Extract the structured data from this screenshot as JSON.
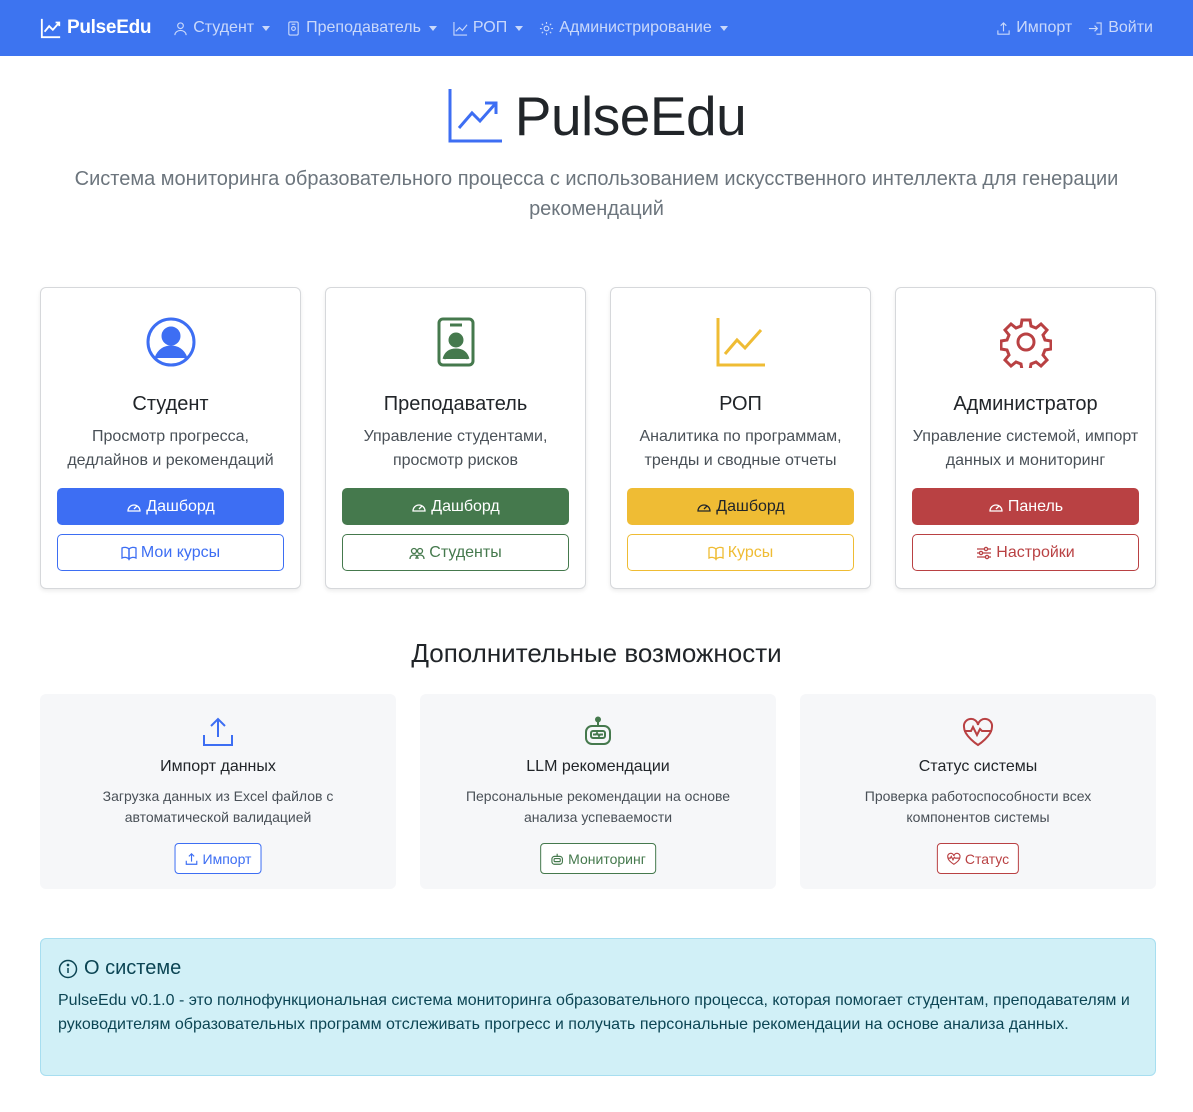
{
  "navbar": {
    "brand": "PulseEdu",
    "items": [
      {
        "label": "Студент",
        "icon": "person-icon"
      },
      {
        "label": "Преподаватель",
        "icon": "badge-icon"
      },
      {
        "label": "РОП",
        "icon": "chart-icon"
      },
      {
        "label": "Администрирование",
        "icon": "gear-icon"
      }
    ],
    "import_label": "Импорт",
    "login_label": "Войти"
  },
  "hero": {
    "title": "PulseEdu",
    "subtitle": "Система мониторинга образовательного процесса с использованием искусственного интеллекта для генерации рекомендаций"
  },
  "roles": [
    {
      "title": "Студент",
      "desc": "Просмотр прогресса, дедлайнов и рекомендаций",
      "primary": "Дашборд",
      "secondary": "Мои курсы",
      "color": "#3d6ef3",
      "icon": "person-circle-icon"
    },
    {
      "title": "Преподаватель",
      "desc": "Управление студентами, просмотр рисков",
      "primary": "Дашборд",
      "secondary": "Студенты",
      "color": "#45794d",
      "icon": "person-badge-icon"
    },
    {
      "title": "РОП",
      "desc": "Аналитика по программам, тренды и сводные отчеты",
      "primary": "Дашборд",
      "secondary": "Курсы",
      "color": "#efbc34",
      "icon": "graph-up-icon"
    },
    {
      "title": "Администратор",
      "desc": "Управление системой, импорт данных и мониторинг",
      "primary": "Панель",
      "secondary": "Настройки",
      "color": "#b94143",
      "icon": "gear-icon"
    }
  ],
  "section_title": "Дополнительные возможности",
  "features": [
    {
      "title": "Импорт данных",
      "desc": "Загрузка данных из Excel файлов с автоматической валидацией",
      "button": "Импорт",
      "color": "#3d6ef3",
      "icon": "upload-icon"
    },
    {
      "title": "LLM рекомендации",
      "desc": "Персональные рекомендации на основе анализа успеваемости",
      "button": "Мониторинг",
      "color": "#45794d",
      "icon": "robot-icon"
    },
    {
      "title": "Статус системы",
      "desc": "Проверка работоспособности всех компонентов системы",
      "button": "Статус",
      "color": "#b94143",
      "icon": "heart-pulse-icon"
    }
  ],
  "about": {
    "title": "О системе",
    "text": "PulseEdu v0.1.0 - это полнофункциональная система мониторинга образовательного процесса, которая помогает студентам, преподавателям и руководителям образовательных программ отслеживать прогресс и получать персональные рекомендации на основе анализа данных."
  }
}
